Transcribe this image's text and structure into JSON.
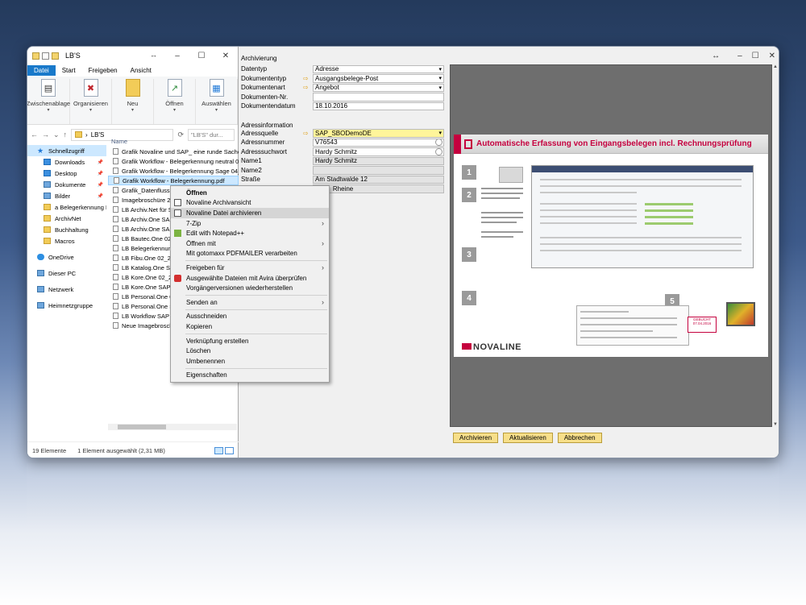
{
  "explorer": {
    "title": "LB'S",
    "tabs": [
      "Datei",
      "Start",
      "Freigeben",
      "Ansicht"
    ],
    "ribbon": [
      {
        "label": "Zwischenablage",
        "icon": "clipboard-icon"
      },
      {
        "label": "Organisieren",
        "icon": "delete-icon"
      },
      {
        "label": "Neu",
        "icon": "new-folder-icon"
      },
      {
        "label": "Öffnen",
        "icon": "open-icon"
      },
      {
        "label": "Auswählen",
        "icon": "select-icon"
      }
    ],
    "address": "LB'S",
    "search_placeholder": "\"LB'S\" dur...",
    "column_header": "Name",
    "nav": [
      {
        "label": "Schnellzugriff",
        "type": "star",
        "selected": true
      },
      {
        "label": "Downloads",
        "type": "blue",
        "pinned": true
      },
      {
        "label": "Desktop",
        "type": "blue",
        "pinned": true
      },
      {
        "label": "Dokumente",
        "type": "pc",
        "pinned": true
      },
      {
        "label": "Bilder",
        "type": "pc",
        "pinned": true
      },
      {
        "label": "a Belegerkennung E",
        "type": "folder"
      },
      {
        "label": "ArchivNet",
        "type": "folder"
      },
      {
        "label": "Buchhaltung",
        "type": "folder"
      },
      {
        "label": "Macros",
        "type": "folder"
      },
      {
        "label": "OneDrive",
        "type": "cloud"
      },
      {
        "label": "Dieser PC",
        "type": "pc"
      },
      {
        "label": "Netzwerk",
        "type": "pc"
      },
      {
        "label": "Heimnetzgruppe",
        "type": "pc"
      }
    ],
    "files": [
      "Grafik Novaline und SAP_ eine runde Sache.pdf",
      "Grafik Workflow - Belegerkennung neutral 04_20",
      "Grafik Workflow - Belegerkennung Sage 04_2016",
      "Grafik Workflow - Belegerkennung.pdf",
      "Grafik_Datenfluss Sa",
      "Imagebroschüre 20",
      "LB Archiv.Net  für S",
      "LB Archiv.One SAP",
      "LB Archiv.One SAP",
      "LB Bautec.One 02_2",
      "LB Belegerkennung",
      "LB Fibu.One 02_201",
      "LB Katalog.One SAP",
      "LB Kore.One  02_201",
      "LB Kore.One SAP 0",
      "LB Personal.One 02",
      "LB Personal.One SA",
      "LB Workflow SAP 05",
      "Neue Imagebrosch"
    ],
    "status_count": "19 Elemente",
    "status_selected": "1 Element ausgewählt (2,31 MB)"
  },
  "context_menu": [
    {
      "label": "Öffnen",
      "bold": true
    },
    {
      "label": "Novaline Archivansicht",
      "icon": "novaline-icon"
    },
    {
      "label": "Novaline Datei archivieren",
      "icon": "novaline-icon",
      "highlight": true
    },
    {
      "label": "7-Zip",
      "sub": true
    },
    {
      "label": "Edit with Notepad++",
      "icon": "notepad-icon"
    },
    {
      "label": "Öffnen mit",
      "sub": true
    },
    {
      "label": "Mit gotomaxx PDFMAILER verarbeiten"
    },
    {
      "sep": true
    },
    {
      "label": "Freigeben für",
      "sub": true
    },
    {
      "label": "Ausgewählte Dateien mit Avira überprüfen",
      "icon": "avira-icon"
    },
    {
      "label": "Vorgängerversionen wiederherstellen"
    },
    {
      "sep": true
    },
    {
      "label": "Senden an",
      "sub": true
    },
    {
      "sep": true
    },
    {
      "label": "Ausschneiden"
    },
    {
      "label": "Kopieren"
    },
    {
      "sep": true
    },
    {
      "label": "Verknüpfung erstellen"
    },
    {
      "label": "Löschen"
    },
    {
      "label": "Umbenennen"
    },
    {
      "sep": true
    },
    {
      "label": "Eigenschaften"
    }
  ],
  "archive": {
    "title": "Archivierung",
    "fields": [
      {
        "label": "Datentyp",
        "value": "Adresse",
        "dd": true
      },
      {
        "label": "Dokumententyp",
        "value": "Ausgangsbelege-Post",
        "dd": true,
        "flag": true
      },
      {
        "label": "Dokumentenart",
        "value": "Angebot",
        "dd": true,
        "flag": true
      },
      {
        "label": "Dokumenten-Nr.",
        "value": ""
      },
      {
        "label": "Dokumentendatum",
        "value": "18.10.2016"
      }
    ],
    "address_section": "Adressinformation",
    "address_fields": [
      {
        "label": "Adressquelle",
        "value": "SAP_SBODemoDE",
        "dd": true,
        "flag": true,
        "yellow": true
      },
      {
        "label": "Adressnummer",
        "value": "V76543",
        "circle": true
      },
      {
        "label": "Adresssuchwort",
        "value": "Hardy Schmitz",
        "circle": true
      },
      {
        "label": "Name1",
        "value": "Hardy Schmitz",
        "grey": true
      },
      {
        "label": "Name2",
        "value": "",
        "grey": true
      },
      {
        "label": "Straße",
        "value": "Am Stadtwalde 12",
        "grey": true
      },
      {
        "label": "",
        "value": "32",
        "value2": "Rheine",
        "grey": true
      }
    ]
  },
  "viewer": {
    "doc_title": "Automatische Erfassung von Eingangsbelegen incl. Rechnungsprüfung",
    "steps": [
      "1",
      "2",
      "3",
      "4",
      "5"
    ],
    "brand": "NOVALINE",
    "stamp": "GEBUCHT 07.04.2016",
    "buttons": [
      "Archivieren",
      "Aktualisieren",
      "Abbrechen"
    ]
  }
}
